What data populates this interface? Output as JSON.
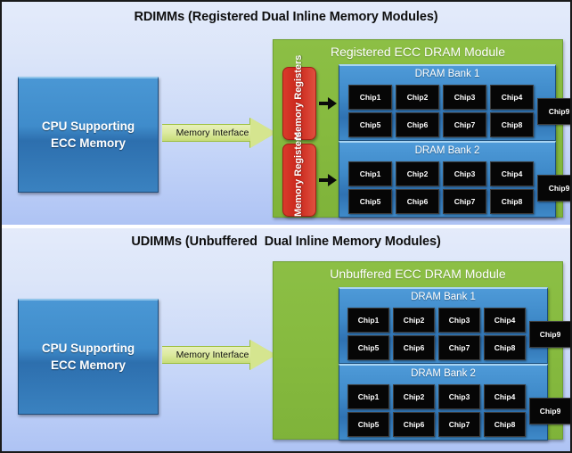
{
  "figure": {
    "background_top": "#e4ebfa",
    "background_bottom": "#aec3f4",
    "module_green": "#86ba3f",
    "bank_blue": "#3f8ac9",
    "register_red": "#c9271c",
    "chip_black": "#060606",
    "arrow_green": "#d5e58f"
  },
  "panels": [
    {
      "id": "rdimm",
      "title": "RDIMMs (Registered Dual Inline Memory Modules)",
      "cpu": {
        "line1": "CPU Supporting",
        "line2": "ECC Memory"
      },
      "interface": {
        "label": "Memory Interface"
      },
      "module": {
        "title": "Registered ECC DRAM Module"
      },
      "registers": [
        {
          "line1": "Memory",
          "line2": "Registers"
        },
        {
          "line1": "Memory",
          "line2": "Registers"
        }
      ],
      "banks": [
        {
          "title": "DRAM Bank 1",
          "row1": [
            "Chip1",
            "Chip2",
            "Chip3",
            "Chip4"
          ],
          "row2": [
            "Chip5",
            "Chip6",
            "Chip7",
            "Chip8"
          ],
          "ecc": "Chip9"
        },
        {
          "title": "DRAM Bank 2",
          "row1": [
            "Chip1",
            "Chip2",
            "Chip3",
            "Chip4"
          ],
          "row2": [
            "Chip5",
            "Chip6",
            "Chip7",
            "Chip8"
          ],
          "ecc": "Chip9"
        }
      ]
    },
    {
      "id": "udimm",
      "title": "UDIMMs (Unbuffered  Dual Inline Memory Modules)",
      "cpu": {
        "line1": "CPU Supporting",
        "line2": "ECC Memory"
      },
      "interface": {
        "label": "Memory Interface"
      },
      "module": {
        "title": "Unbuffered ECC DRAM Module"
      },
      "registers": [],
      "banks": [
        {
          "title": "DRAM Bank 1",
          "row1": [
            "Chip1",
            "Chip2",
            "Chip3",
            "Chip4"
          ],
          "row2": [
            "Chip5",
            "Chip6",
            "Chip7",
            "Chip8"
          ],
          "ecc": "Chip9"
        },
        {
          "title": "DRAM Bank 2",
          "row1": [
            "Chip1",
            "Chip2",
            "Chip3",
            "Chip4"
          ],
          "row2": [
            "Chip5",
            "Chip6",
            "Chip7",
            "Chip8"
          ],
          "ecc": "Chip9"
        }
      ]
    }
  ]
}
